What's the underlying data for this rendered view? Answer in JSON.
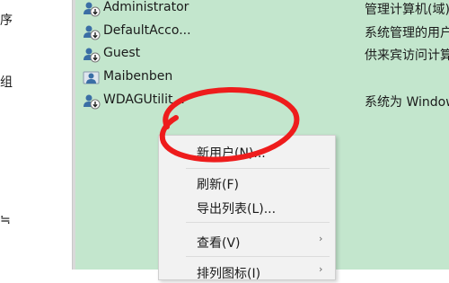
{
  "left_pane": {
    "fragments": [
      "序",
      "组",
      "≒"
    ]
  },
  "users": [
    {
      "name": "Administrator",
      "description": "管理计算机(域)",
      "icon": "disabled-user-icon"
    },
    {
      "name": "DefaultAcco...",
      "description": "系统管理的用户",
      "icon": "disabled-user-icon"
    },
    {
      "name": "Guest",
      "description": "供来宾访问计算",
      "icon": "disabled-user-icon"
    },
    {
      "name": "Maibenben",
      "description": "",
      "icon": "user-icon"
    },
    {
      "name": "WDAGUtilit...",
      "description": "系统为 Windows",
      "icon": "disabled-user-icon"
    }
  ],
  "context_menu": {
    "new_user": "新用户(N)...",
    "refresh": "刷新(F)",
    "export_list": "导出列表(L)...",
    "view": "查看(V)",
    "view_arrow": "›",
    "arrange_icons": "排列图标(I)",
    "arrange_arrow": "›"
  },
  "colors": {
    "list_background": "#c3e6cd",
    "annotation_red": "#ee1c1c"
  }
}
